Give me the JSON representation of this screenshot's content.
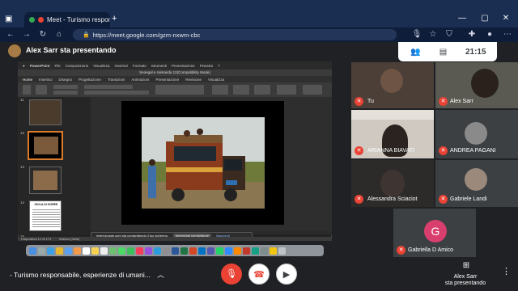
{
  "browser": {
    "tab_title": "Meet - Turismo responsab",
    "url": "https://meet.google.com/gzm-nxwm-cbc"
  },
  "meet": {
    "presenter_banner": "Alex Sarr sta presentando",
    "clock": "21:15",
    "meeting_title": "- Turismo responsabile, esperienze di umani...",
    "presenting_label": "Alex Sarr\nsta presentando"
  },
  "shared_screen": {
    "app_name": "PowerPoint",
    "mac_menu": [
      "File",
      "Composizione",
      "Visualizza",
      "Inserisci",
      "Formato",
      "Strumenti",
      "Presentazione",
      "Finestra",
      "?"
    ],
    "doc_title": "Senegal e raimanda 12(Compatibility Mode)",
    "ribbon_tabs": [
      "Home",
      "Inserisci",
      "Disegno",
      "Progettazione",
      "Transizioni",
      "Animazioni",
      "Presentazione",
      "Revisione",
      "Visualizza"
    ],
    "slide_numbers": [
      "11",
      "12",
      "13",
      "14",
      "15"
    ],
    "thumb14_title": "ISOLA DI GOREE",
    "notes_placeholder": "Fare clic per inserire le note",
    "sharing_notice": "meet.google.com sta condividendo il tuo schermo.",
    "sharing_stop": "Interrompi condivisione",
    "sharing_hide": "Nascondi",
    "status_slide": "Diapositiva 12 di 173",
    "status_lang": "Italiano (Italia)"
  },
  "participants": [
    {
      "name": "Tu",
      "muted": true
    },
    {
      "name": "Alex Sarr",
      "muted": true
    },
    {
      "name": "ARIANNA BIAVATI",
      "muted": true
    },
    {
      "name": "ANDREA PAGANI",
      "muted": true
    },
    {
      "name": "Alessandra Sciaciot",
      "muted": true
    },
    {
      "name": "Gabriele Landi",
      "muted": true
    },
    {
      "name": "Gabriella D Amico",
      "muted": true,
      "initial": "G"
    }
  ],
  "colors": {
    "accent_red": "#ea4335",
    "avatar_pink": "#d93f6e",
    "meet_bg": "#202124"
  }
}
